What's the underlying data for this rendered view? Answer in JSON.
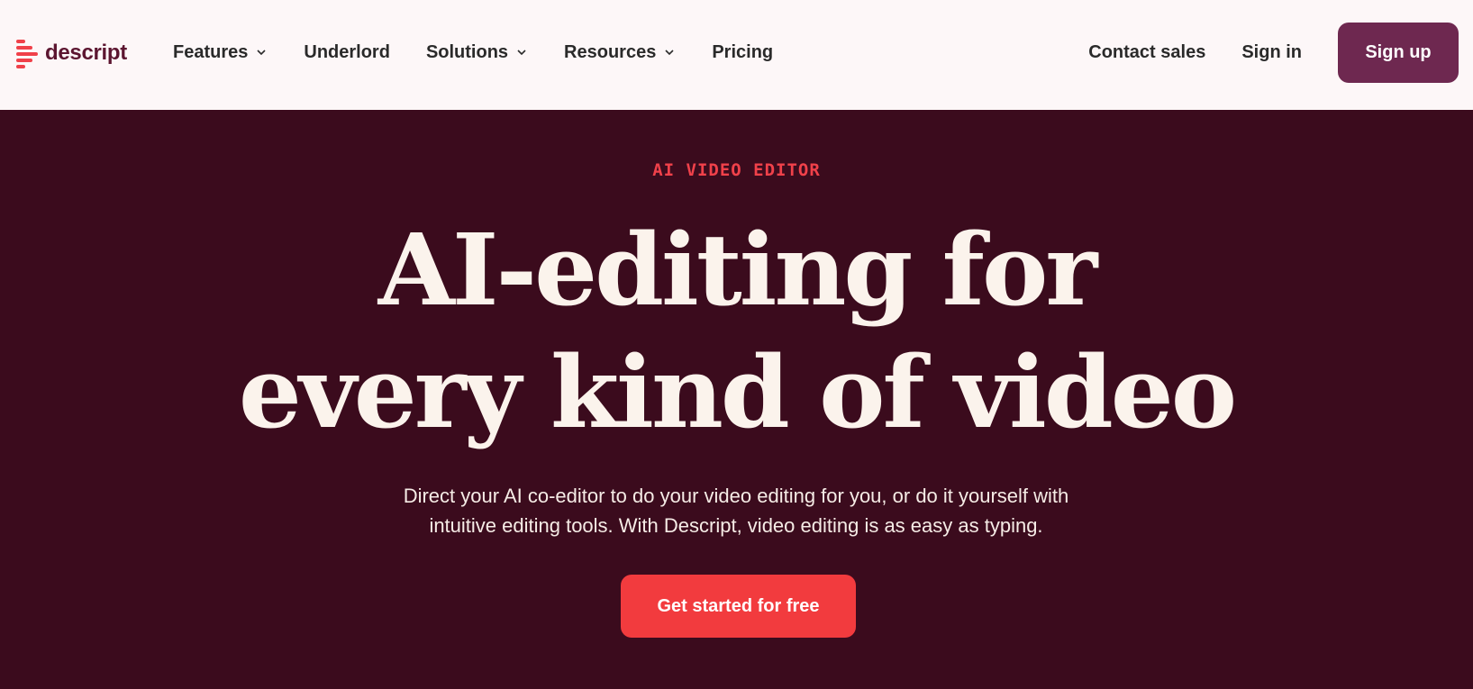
{
  "brand": {
    "name": "descript",
    "accent_color": "#f0414a",
    "primary_color": "#6e2850",
    "logo_icon": "descript-logo-icon"
  },
  "nav": {
    "items": [
      {
        "label": "Features",
        "has_dropdown": true
      },
      {
        "label": "Underlord",
        "has_dropdown": false
      },
      {
        "label": "Solutions",
        "has_dropdown": true
      },
      {
        "label": "Resources",
        "has_dropdown": true
      },
      {
        "label": "Pricing",
        "has_dropdown": false
      }
    ],
    "contact_sales": "Contact sales",
    "sign_in": "Sign in",
    "sign_up": "Sign up",
    "dropdown_icon": "chevron-down-icon"
  },
  "hero": {
    "eyebrow": "AI VIDEO EDITOR",
    "headline_line1": "AI-editing for",
    "headline_line2": "every kind of video",
    "subtext_line1": "Direct your AI co-editor to do your video editing for you, or do it yourself with",
    "subtext_line2": "intuitive editing tools. With Descript, video editing is as easy as typing.",
    "cta": "Get started for free",
    "background_color": "#3b0b1d",
    "cta_color": "#f23b3e"
  }
}
